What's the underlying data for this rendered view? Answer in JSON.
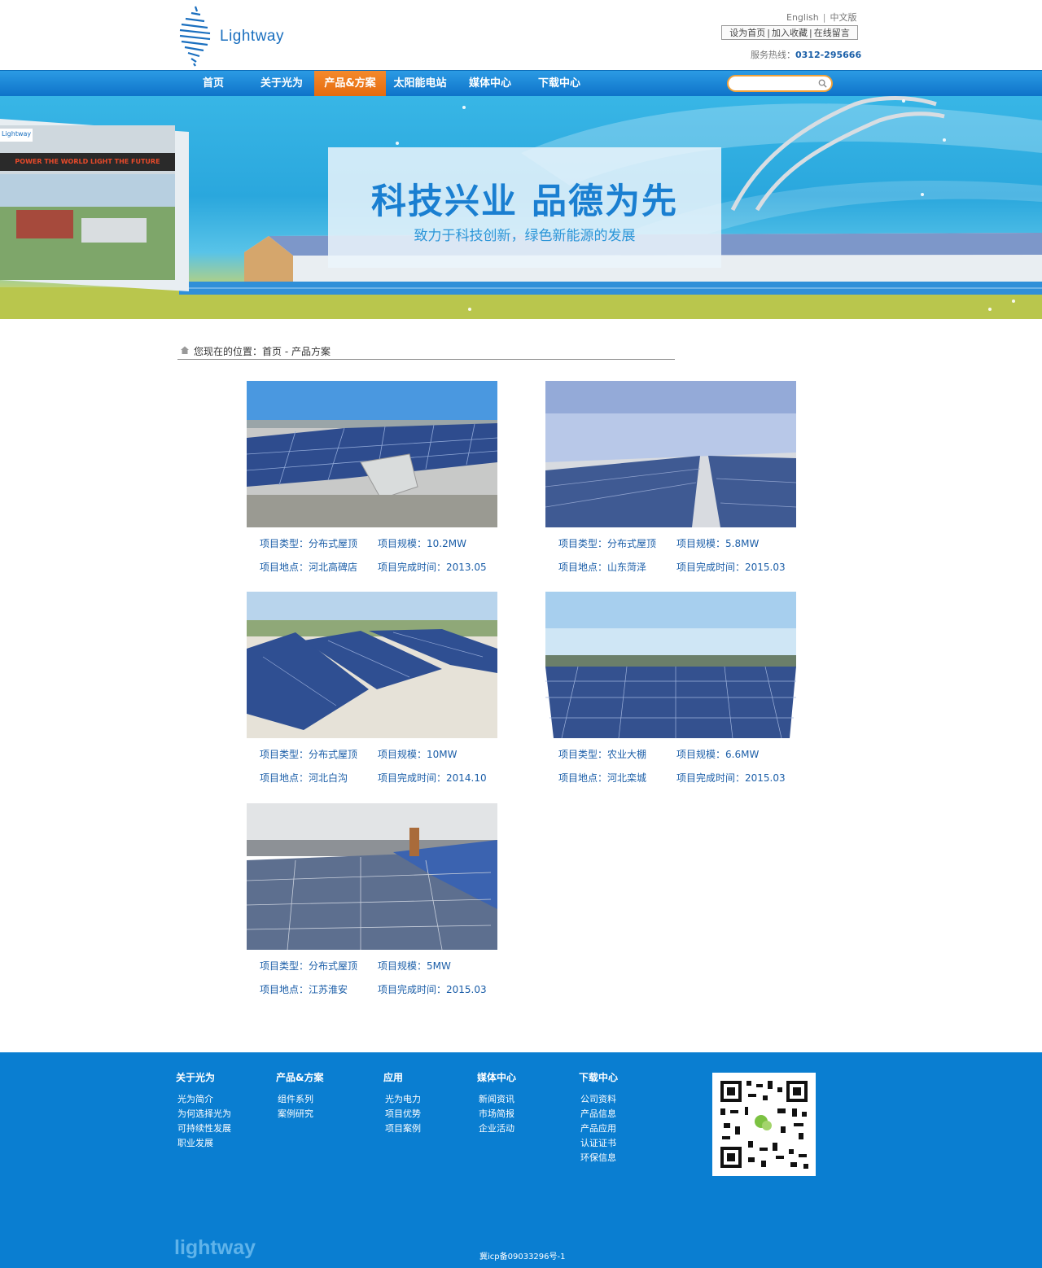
{
  "header": {
    "logo_text": "Lightway",
    "lang_en": "English",
    "lang_sep": "|",
    "lang_cn": "中文版",
    "quick_links": [
      "设为首页",
      "|",
      "加入收藏",
      "|",
      "在线留言"
    ],
    "hotline_label": "服务热线：",
    "hotline_number": "0312-295666"
  },
  "nav": {
    "items": [
      "首页",
      "关于光为",
      "产品&方案",
      "太阳能电站",
      "媒体中心",
      "下载中心"
    ],
    "active_index": 2,
    "search_placeholder": ""
  },
  "banner": {
    "title": "科技兴业  品德为先",
    "subtitle": "致力于科技创新，绿色新能源的发展",
    "sign_text": "POWER THE WORLD LIGHT THE FUTURE",
    "sign_brand": "Lightway"
  },
  "breadcrumb": {
    "text": "您现在的位置：首页 - 产品方案"
  },
  "projects": [
    {
      "type": "项目类型：分布式屋顶",
      "scale": "项目规模：10.2MW",
      "location": "项目地点：河北高碑店",
      "date": "项目完成时间：2013.05"
    },
    {
      "type": "项目类型：分布式屋顶",
      "scale": "项目规模：5.8MW",
      "location": "项目地点：山东菏泽",
      "date": "项目完成时间：2015.03"
    },
    {
      "type": "项目类型：分布式屋顶",
      "scale": "项目规模：10MW",
      "location": "项目地点：河北白沟",
      "date": "项目完成时间：2014.10"
    },
    {
      "type": "项目类型：农业大棚",
      "scale": "项目规模：6.6MW",
      "location": "项目地点：河北栾城",
      "date": "项目完成时间：2015.03"
    },
    {
      "type": "项目类型：分布式屋顶",
      "scale": "项目规模：5MW",
      "location": "项目地点：江苏淮安",
      "date": "项目完成时间：2015.03"
    }
  ],
  "footer": {
    "columns": [
      {
        "title": "关于光为",
        "links": [
          "光为简介",
          "为何选择光为",
          "可持续性发展",
          "职业发展"
        ]
      },
      {
        "title": "产品&方案",
        "links": [
          "组件系列",
          "案例研究"
        ]
      },
      {
        "title": "应用",
        "links": [
          "光为电力",
          "项目优势",
          "项目案例"
        ]
      },
      {
        "title": "媒体中心",
        "links": [
          "新闻资讯",
          "市场简报",
          "企业活动"
        ]
      },
      {
        "title": "下载中心",
        "links": [
          "公司资料",
          "产品信息",
          "产品应用",
          "认证证书",
          "环保信息"
        ]
      }
    ],
    "logo_text": "lightway",
    "icp": "冀icp备09033296号-1"
  },
  "colors": {
    "primary": "#0e73c9",
    "active_nav": "#e56a0d",
    "footer_bg": "#0a7ed1",
    "project_text": "#1b5ea8"
  }
}
